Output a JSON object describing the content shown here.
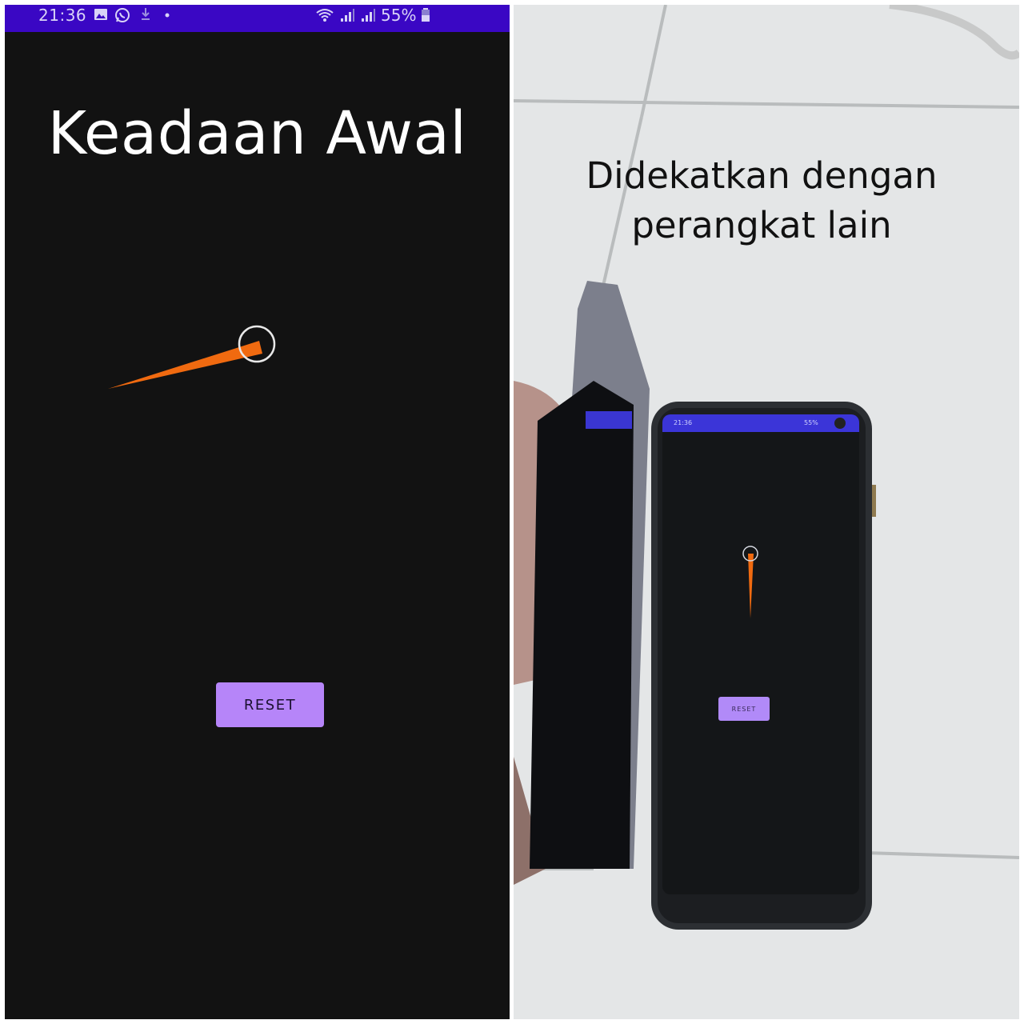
{
  "left": {
    "status_bar": {
      "time": "21:36",
      "battery": "55%",
      "icons": [
        "gallery-icon",
        "whatsapp-icon",
        "download-icon",
        "dot-icon",
        "wifi-icon",
        "signal-icon",
        "signal-icon",
        "battery-icon"
      ],
      "color": "#3a07c4"
    },
    "title": "Keadaan Awal",
    "reset_label": "RESET",
    "colors": {
      "background": "#121212",
      "needle": "#f06a10",
      "button": "#b685f9"
    }
  },
  "right": {
    "caption_line1": "Didekatkan dengan",
    "caption_line2": "perangkat lain",
    "phone": {
      "status_time": "21:36",
      "status_battery": "55%",
      "reset_label": "RESET"
    }
  }
}
